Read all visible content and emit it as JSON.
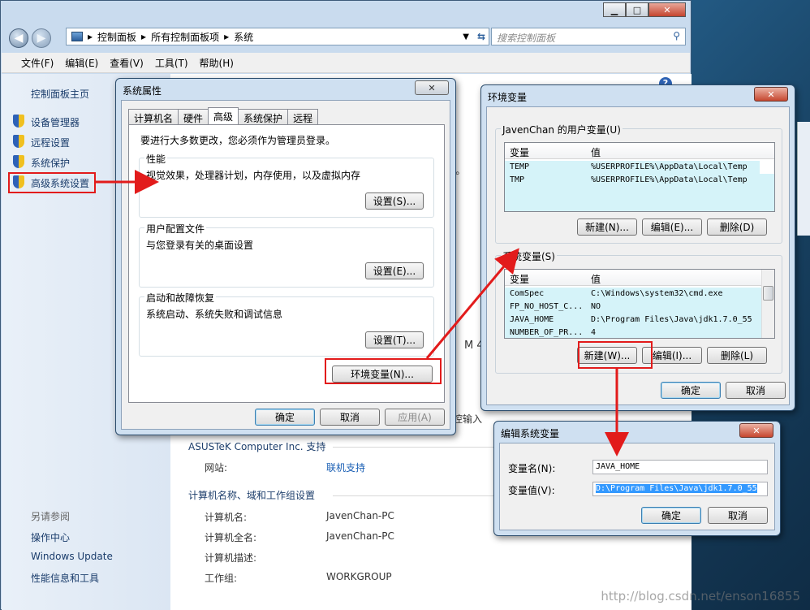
{
  "explorer": {
    "breadcrumb": [
      "控制面板",
      "所有控制面板项",
      "系统"
    ],
    "search_placeholder": "搜索控制面板",
    "menu": [
      "文件(F)",
      "编辑(E)",
      "查看(V)",
      "工具(T)",
      "帮助(H)"
    ],
    "left_home": "控制面板主页",
    "left_items": [
      "设备管理器",
      "远程设置",
      "系统保护",
      "高级系统设置"
    ],
    "see_also_title": "另请参阅",
    "see_also": [
      "操作中心",
      "Windows Update",
      "性能信息和工具"
    ],
    "support_title": "ASUSTeK Computer Inc. 支持",
    "website_label": "网站:",
    "website_link": "联机支持",
    "computer_section_title": "计算机名称、域和工作组设置",
    "computer_rows": [
      {
        "label": "计算机名:",
        "value": "JavenChan-PC"
      },
      {
        "label": "计算机全名:",
        "value": "JavenChan-PC"
      },
      {
        "label": "计算机描述:",
        "value": ""
      },
      {
        "label": "工作组:",
        "value": "WORKGROUP"
      }
    ],
    "partial_m": "M 4",
    "partial_input": "控输入",
    "partial_l": "l。"
  },
  "sysprops": {
    "title": "系统属性",
    "tabs": [
      "计算机名",
      "硬件",
      "高级",
      "系统保护",
      "远程"
    ],
    "active_tab": "高级",
    "admin_note": "要进行大多数更改，您必须作为管理员登录。",
    "groups": [
      {
        "title": "性能",
        "desc": "视觉效果，处理器计划，内存使用，以及虚拟内存",
        "button": "设置(S)..."
      },
      {
        "title": "用户配置文件",
        "desc": "与您登录有关的桌面设置",
        "button": "设置(E)..."
      },
      {
        "title": "启动和故障恢复",
        "desc": "系统启动、系统失败和调试信息",
        "button": "设置(T)..."
      }
    ],
    "env_button": "环境变量(N)...",
    "ok": "确定",
    "cancel": "取消",
    "apply": "应用(A)"
  },
  "envvars": {
    "title": "环境变量",
    "user_group": "JavenChan 的用户变量(U)",
    "col_var": "变量",
    "col_val": "值",
    "user_vars": [
      {
        "name": "TEMP",
        "value": "%USERPROFILE%\\AppData\\Local\\Temp"
      },
      {
        "name": "TMP",
        "value": "%USERPROFILE%\\AppData\\Local\\Temp"
      }
    ],
    "user_buttons": [
      "新建(N)...",
      "编辑(E)...",
      "删除(D)"
    ],
    "sys_group": "系统变量(S)",
    "sys_vars": [
      {
        "name": "ComSpec",
        "value": "C:\\Windows\\system32\\cmd.exe"
      },
      {
        "name": "FP_NO_HOST_C...",
        "value": "NO"
      },
      {
        "name": "JAVA_HOME",
        "value": "D:\\Program Files\\Java\\jdk1.7.0_55"
      },
      {
        "name": "NUMBER_OF_PR...",
        "value": "4"
      }
    ],
    "sys_buttons": [
      "新建(W)...",
      "编辑(I)...",
      "删除(L)"
    ],
    "ok": "确定",
    "cancel": "取消"
  },
  "editvar": {
    "title": "编辑系统变量",
    "name_label": "变量名(N):",
    "name_value": "JAVA_HOME",
    "value_label": "变量值(V):",
    "value_value": "D:\\Program Files\\Java\\jdk1.7.0_55",
    "ok": "确定",
    "cancel": "取消"
  },
  "watermark": "http://blog.csdn.net/enson16855",
  "colors": {
    "highlight_red": "#e21b1b",
    "link_blue": "#1a5fb4",
    "selection": "#3399ff"
  }
}
